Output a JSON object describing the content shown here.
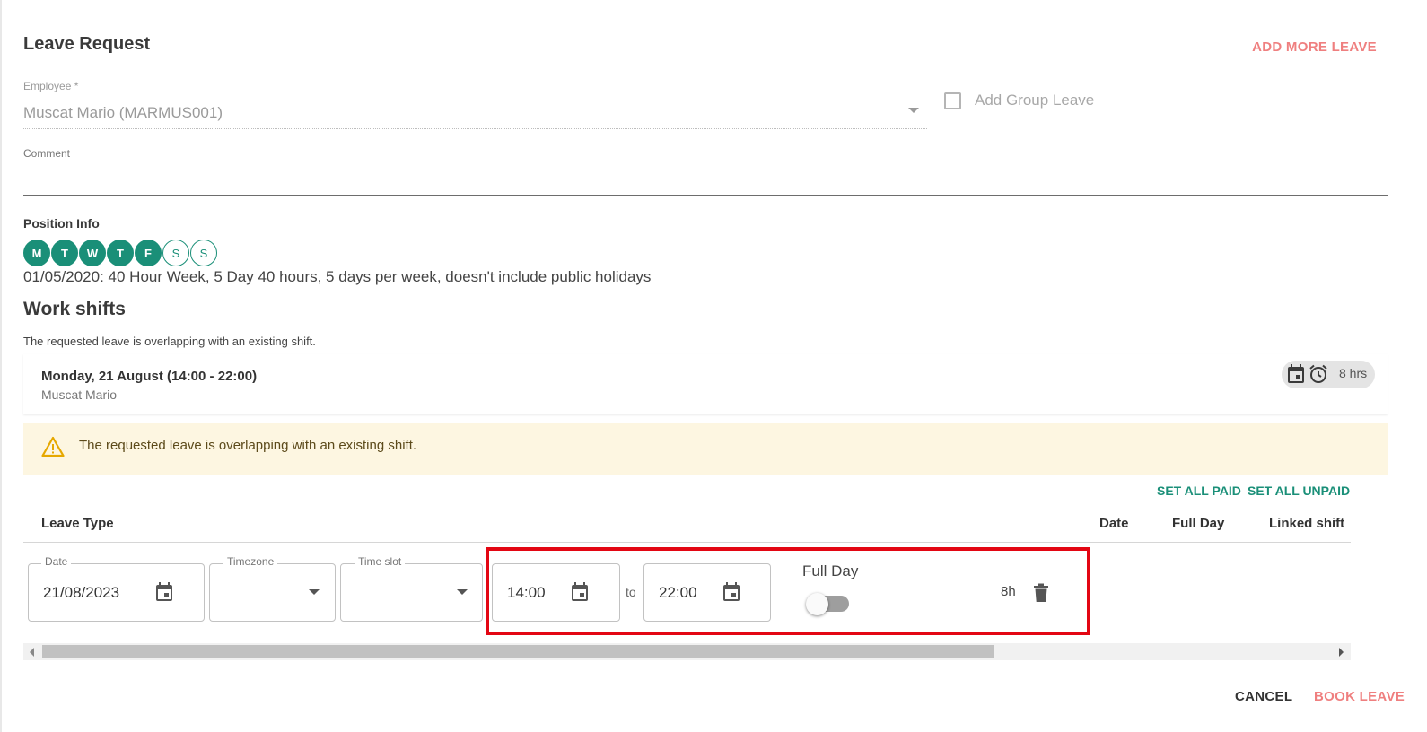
{
  "dialog": {
    "title": "Leave Request",
    "add_more_label": "ADD MORE LEAVE",
    "employee_label": "Employee *",
    "employee_value": "Muscat Mario (MARMUS001)",
    "group_leave_label": "Add Group Leave",
    "comment_label": "Comment"
  },
  "position": {
    "title": "Position Info",
    "days": [
      {
        "letter": "M",
        "active": true
      },
      {
        "letter": "T",
        "active": true
      },
      {
        "letter": "W",
        "active": true
      },
      {
        "letter": "T",
        "active": true
      },
      {
        "letter": "F",
        "active": true
      },
      {
        "letter": "S",
        "active": false
      },
      {
        "letter": "S",
        "active": false
      }
    ],
    "description": "01/05/2020: 40 Hour Week, 5 Day 40 hours, 5 days per week, doesn't include public holidays"
  },
  "work_shifts": {
    "title": "Work shifts",
    "note": "The requested leave is overlapping with an existing shift.",
    "shift": {
      "title": "Monday, 21 August (14:00 - 22:00)",
      "employee": "Muscat Mario",
      "hours": "8 hrs"
    },
    "warning": "The requested leave is overlapping with an existing shift."
  },
  "leave_table": {
    "set_all_paid": "SET ALL PAID",
    "set_all_unpaid": "SET ALL UNPAID",
    "headers": {
      "leave_type": "Leave Type",
      "date": "Date",
      "full_day": "Full Day",
      "linked_shift": "Linked shift"
    },
    "row": {
      "date_label": "Date",
      "date_value": "21/08/2023",
      "timezone_label": "Timezone",
      "timezone_value": "",
      "timeslot_label": "Time slot",
      "timeslot_value": "",
      "start_time": "14:00",
      "to_label": "to",
      "end_time": "22:00",
      "full_day_label": "Full Day",
      "full_day_on": false,
      "hours": "8h"
    }
  },
  "footer": {
    "cancel_label": "CANCEL",
    "book_label": "BOOK LEAVE"
  },
  "colors": {
    "accent_green": "#1a8f78",
    "accent_red": "#ef7f7f",
    "highlight_red": "#e30613",
    "warning_bg": "#fdf6e1"
  }
}
